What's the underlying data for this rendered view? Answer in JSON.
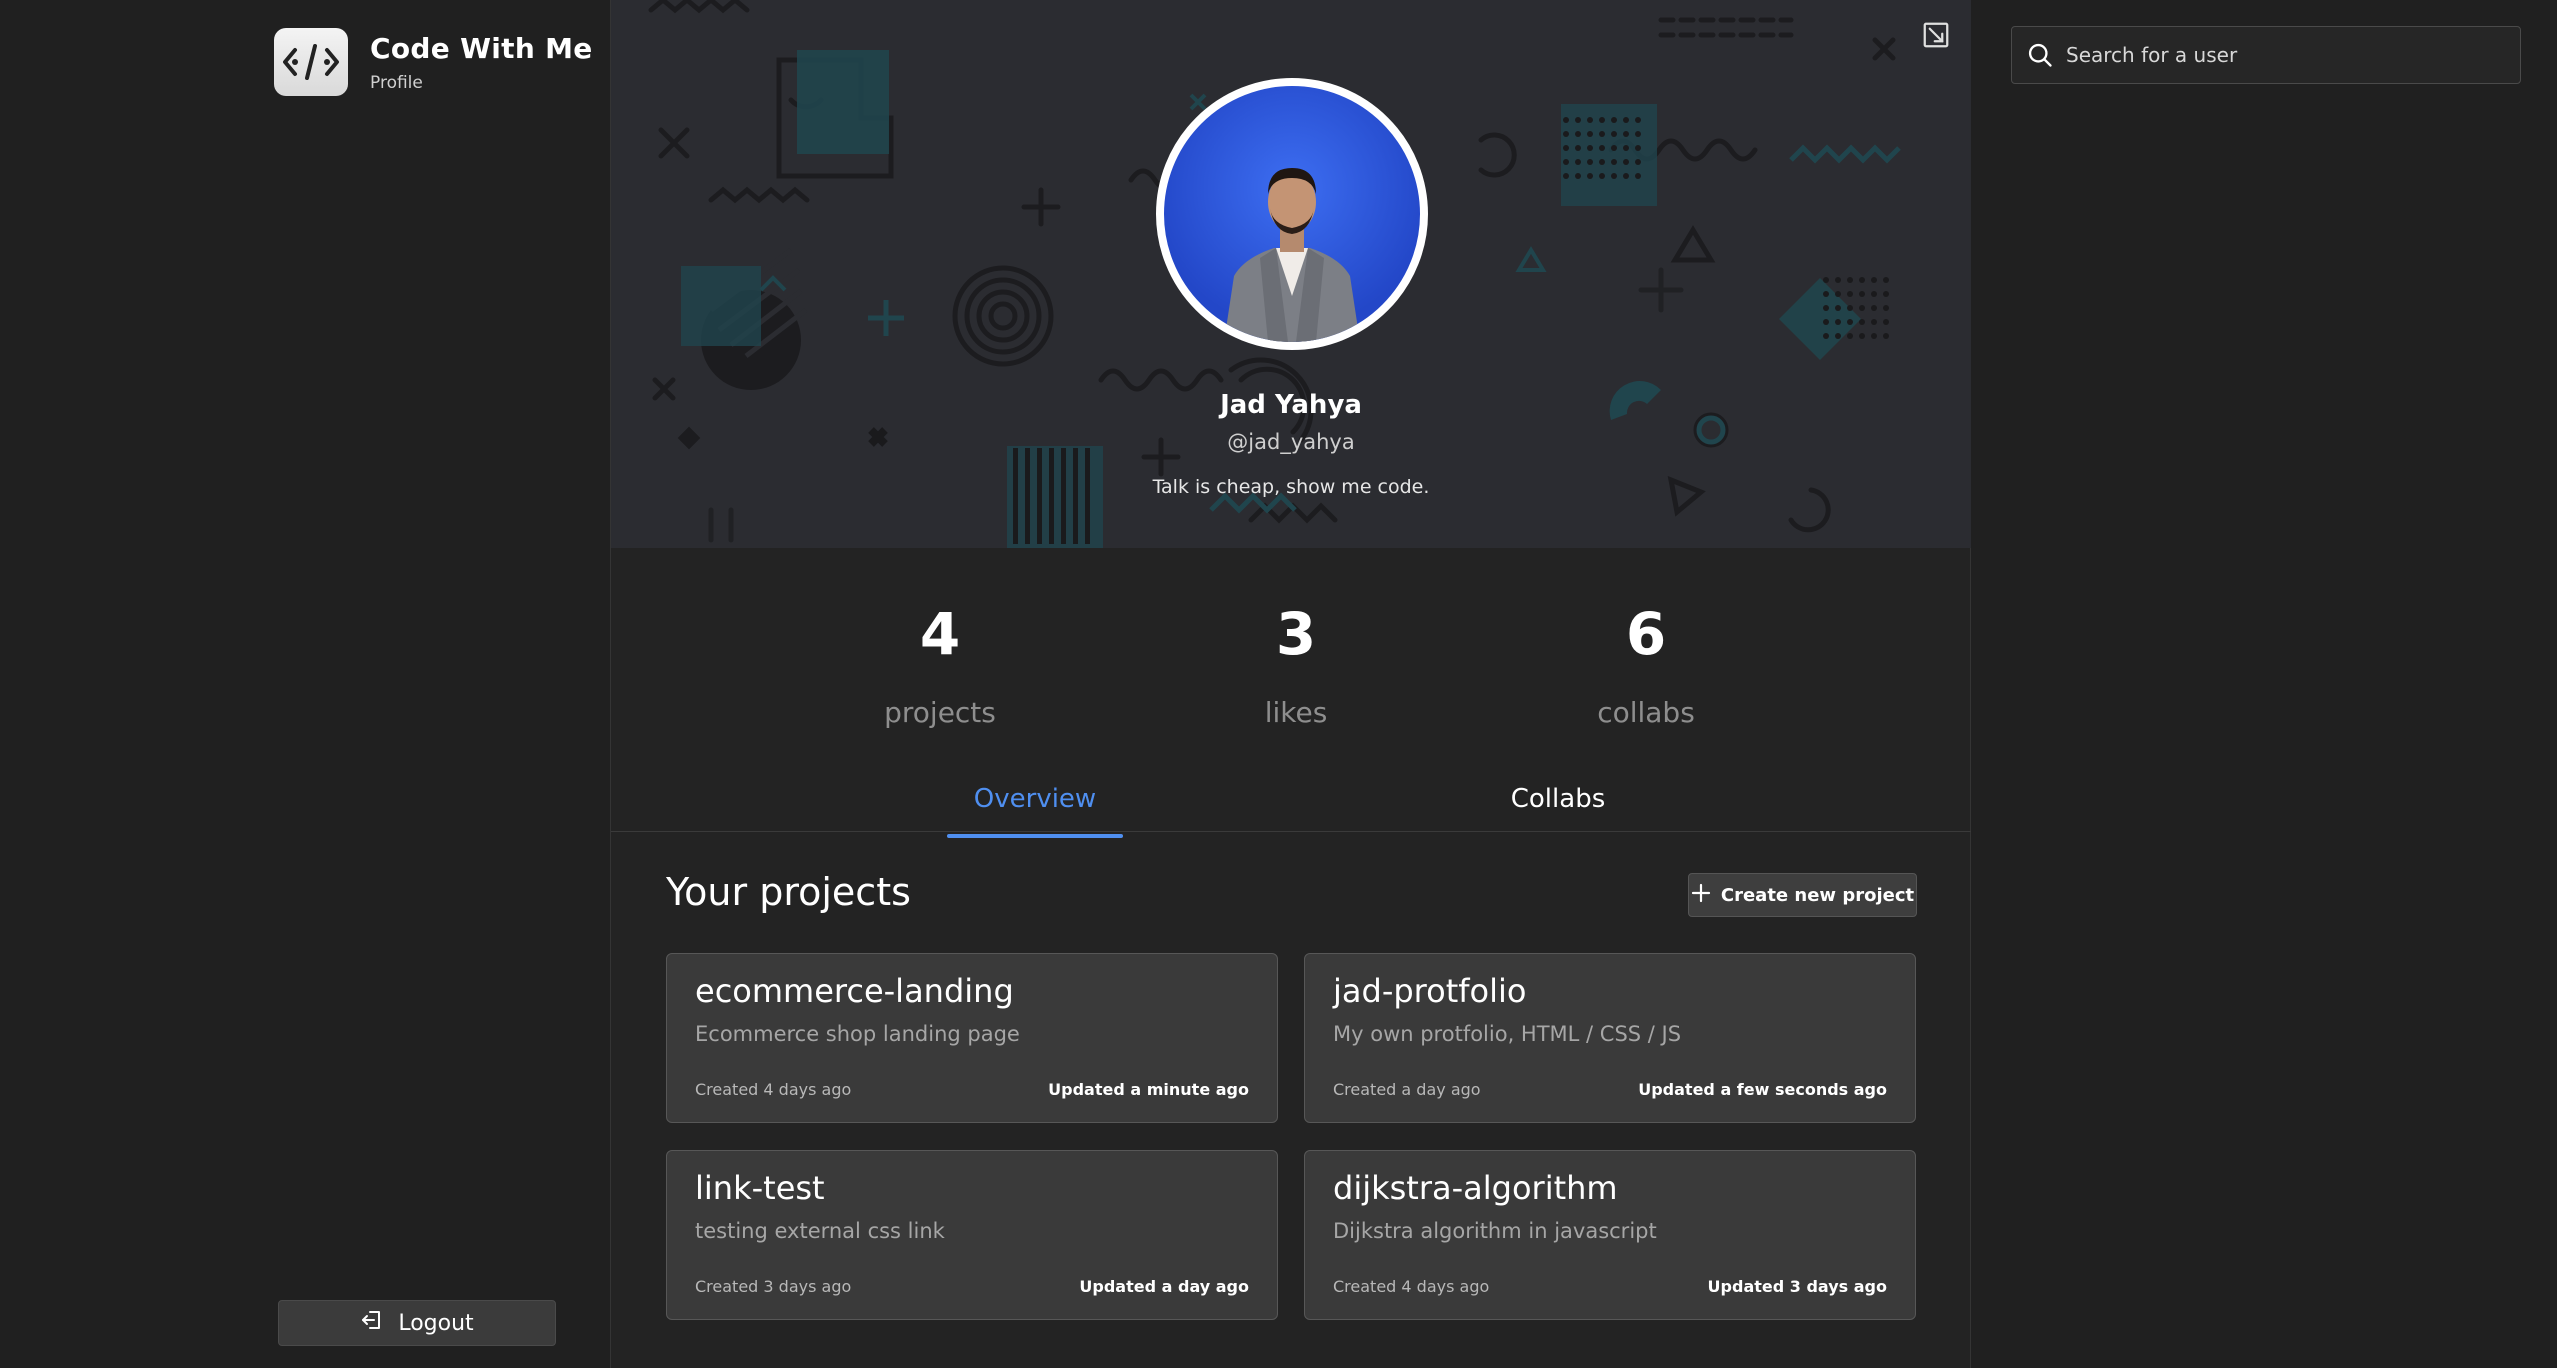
{
  "app": {
    "name": "Code With Me",
    "section": "Profile"
  },
  "sidebar": {
    "logout_label": "Logout"
  },
  "profile": {
    "name": "Jad Yahya",
    "handle": "@jad_yahya",
    "bio": "Talk is cheap, show me code."
  },
  "stats": [
    {
      "value": "4",
      "label": "projects"
    },
    {
      "value": "3",
      "label": "likes"
    },
    {
      "value": "6",
      "label": "collabs"
    }
  ],
  "tabs": [
    {
      "label": "Overview",
      "active": true
    },
    {
      "label": "Collabs",
      "active": false
    }
  ],
  "projects_section": {
    "title": "Your projects",
    "create_label": "Create new project"
  },
  "projects": [
    {
      "title": "ecommerce-landing",
      "description": "Ecommerce shop landing page",
      "created": "Created 4 days ago",
      "updated": "Updated a minute ago"
    },
    {
      "title": "jad-protfolio",
      "description": "My own protfolio, HTML / CSS / JS",
      "created": "Created a day ago",
      "updated": "Updated a few seconds ago"
    },
    {
      "title": "link-test",
      "description": "testing external css link",
      "created": "Created 3 days ago",
      "updated": "Updated a day ago"
    },
    {
      "title": "dijkstra-algorithm",
      "description": "Dijkstra algorithm in javascript",
      "created": "Created 4 days ago",
      "updated": "Updated 3 days ago"
    }
  ],
  "search": {
    "placeholder": "Search for a user",
    "value": ""
  },
  "colors": {
    "accent": "#4f8ff0",
    "background": "#202020",
    "card": "#3a3a3a",
    "cover": "#2b2c31",
    "avatar_bg": "#2f5be0"
  },
  "icons": [
    "code-logo-icon",
    "logout-icon",
    "expand-icon",
    "plus-icon",
    "search-icon"
  ]
}
